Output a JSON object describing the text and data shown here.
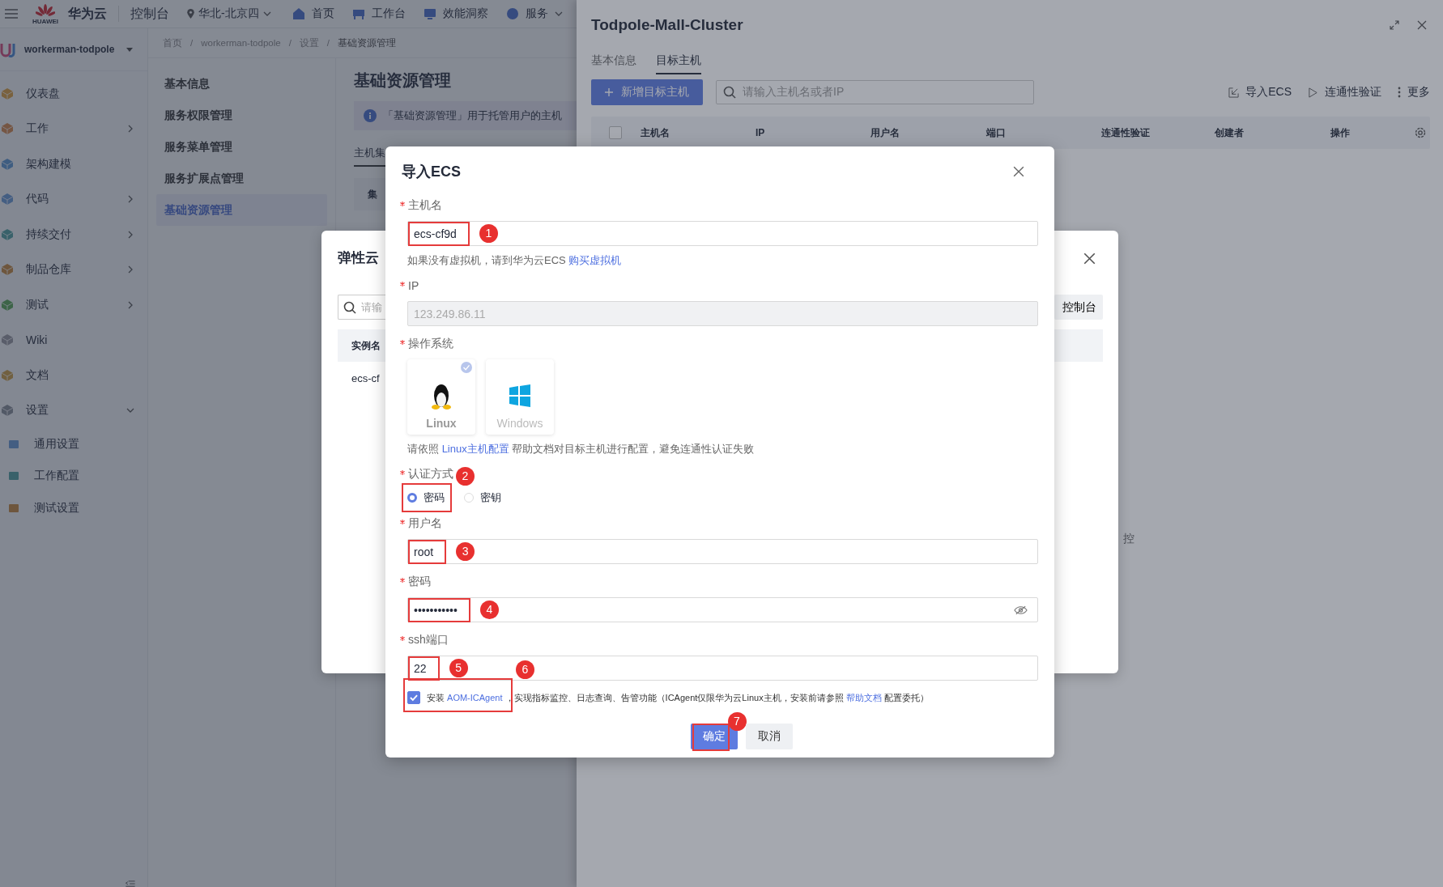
{
  "topbar": {
    "logo_caption": "HUAWEI",
    "brand": "华为云",
    "console": "控制台",
    "region": "华北-北京四",
    "nav": [
      {
        "label": "首页",
        "caret": false
      },
      {
        "label": "工作台",
        "caret": false
      },
      {
        "label": "效能洞察",
        "caret": false
      },
      {
        "label": "服务",
        "caret": true
      }
    ]
  },
  "sidebar": {
    "project": "workerman-todpole",
    "items": [
      {
        "label": "仪表盘",
        "kind": "link"
      },
      {
        "label": "工作",
        "kind": "group",
        "expanded": false
      },
      {
        "label": "架构建模",
        "kind": "link"
      },
      {
        "label": "代码",
        "kind": "group",
        "expanded": false
      },
      {
        "label": "持续交付",
        "kind": "group",
        "expanded": false
      },
      {
        "label": "制品仓库",
        "kind": "group",
        "expanded": false
      },
      {
        "label": "测试",
        "kind": "group",
        "expanded": false
      },
      {
        "label": "Wiki",
        "kind": "link"
      },
      {
        "label": "文档",
        "kind": "link"
      },
      {
        "label": "设置",
        "kind": "group",
        "expanded": true,
        "children": [
          {
            "label": "通用设置"
          },
          {
            "label": "工作配置"
          },
          {
            "label": "测试设置"
          }
        ]
      }
    ]
  },
  "breadcrumb": [
    {
      "label": "首页"
    },
    {
      "separator": "/",
      "label": "workerman-todpole"
    },
    {
      "separator": "/",
      "label": "设置"
    },
    {
      "separator": "/",
      "label": "基础资源管理"
    }
  ],
  "settings_menu": [
    {
      "label": "基本信息",
      "selected": false
    },
    {
      "label": "服务权限管理",
      "selected": false
    },
    {
      "label": "服务菜单管理",
      "selected": false
    },
    {
      "label": "服务扩展点管理",
      "selected": false
    },
    {
      "label": "基础资源管理",
      "selected": true
    }
  ],
  "content": {
    "title": "基础资源管理",
    "info": "「基础资源管理」用于托管用户的主机",
    "tab": "主机集",
    "table_header": "集"
  },
  "drawer": {
    "title": "Todpole-Mall-Cluster",
    "tabs": [
      {
        "label": "基本信息",
        "selected": false
      },
      {
        "label": "目标主机",
        "selected": true
      }
    ],
    "add_button": "新增目标主机",
    "search_placeholder": "请输入主机名或者IP",
    "actions": [
      {
        "label": "导入ECS",
        "kind": "import"
      },
      {
        "label": "连通性验证",
        "kind": "play"
      },
      {
        "label": "更多",
        "kind": "more"
      }
    ],
    "select_all_checked": false,
    "columns": [
      "主机名",
      "IP",
      "用户名",
      "端口",
      "连通性验证",
      "创建者",
      "操作"
    ],
    "empty_fragment": "控"
  },
  "ecs_list_dialog": {
    "title": "弹性云",
    "search_placeholder": "请输",
    "console_button": "控制台",
    "column_1": "实例名",
    "row_1": "ecs-cf"
  },
  "modal": {
    "title": "导入ECS",
    "hostname": {
      "label": "主机名",
      "required": true,
      "value": "ecs-cf9d",
      "annotation": "1"
    },
    "hostname_help": {
      "text": "如果没有虚拟机，请到华为云ECS",
      "link": "购买虚拟机"
    },
    "ip": {
      "label": "IP",
      "required": true,
      "value": "123.249.86.11",
      "disabled": true
    },
    "os": {
      "label": "操作系统",
      "required": true,
      "options": [
        {
          "label": "Linux",
          "kind": "linux",
          "selected": true
        },
        {
          "label": "Windows",
          "kind": "windows",
          "selected": false
        }
      ]
    },
    "os_help": {
      "before": "请依照",
      "link": "Linux主机配置",
      "after": "帮助文档对目标主机进行配置，避免连通性认证失败"
    },
    "auth": {
      "label": "认证方式",
      "required": true,
      "annotation": "2",
      "options": [
        {
          "label": "密码",
          "selected": true
        },
        {
          "label": "密钥",
          "selected": false
        }
      ]
    },
    "username": {
      "label": "用户名",
      "required": true,
      "value": "root",
      "annotation": "3"
    },
    "password": {
      "label": "密码",
      "required": true,
      "value": "•••••••••••",
      "annotation": "4"
    },
    "port": {
      "label": "ssh端口",
      "required": true,
      "value": "22",
      "annotation": "5"
    },
    "agent": {
      "checked": true,
      "before": "安装",
      "link": "AOM-ICAgent",
      "middle": "，实现指标监控、日志查询、告管功能（ICAgent仅限华为云Linux主机，安装前请参照",
      "link2": "帮助文档",
      "after": "配置委托）",
      "annotation": "6"
    },
    "buttons": [
      {
        "label": "确定",
        "kind": "primary",
        "annotation": "7"
      },
      {
        "label": "取消",
        "kind": "default"
      }
    ]
  }
}
